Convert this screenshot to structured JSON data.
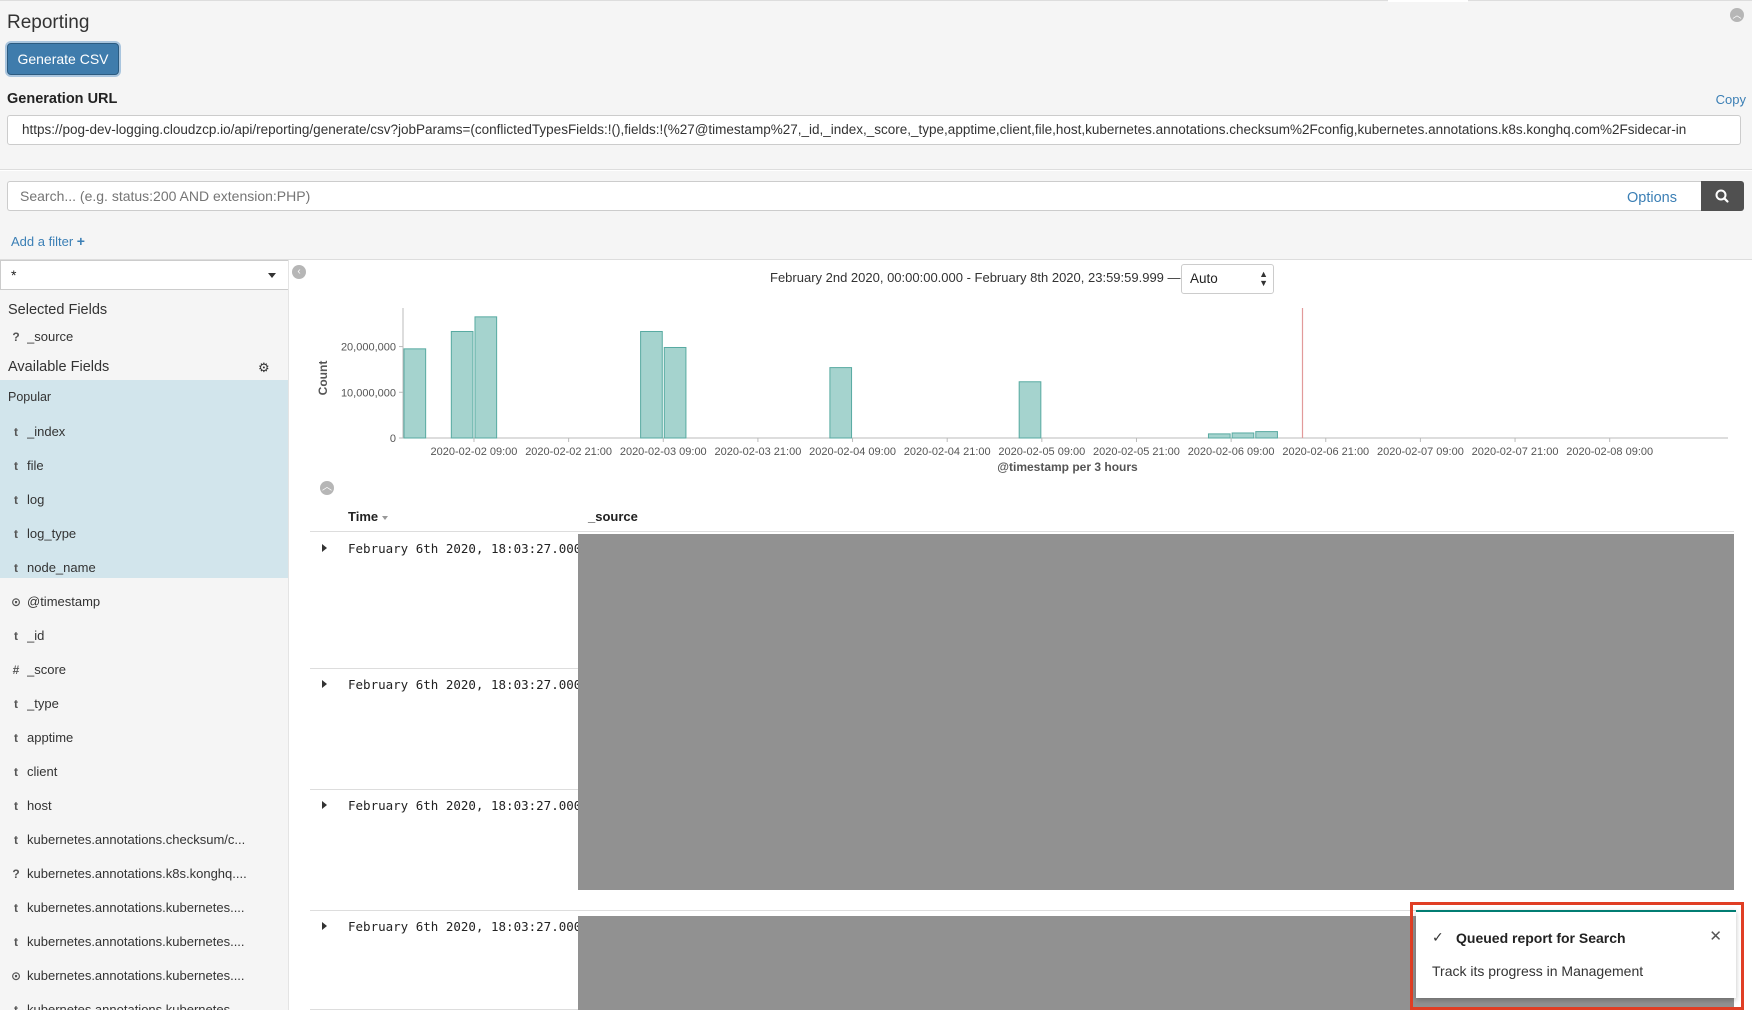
{
  "reporting": {
    "title": "Reporting",
    "generate_button": "Generate CSV",
    "generation_url_label": "Generation URL",
    "copy_label": "Copy",
    "url": "https://pog-dev-logging.cloudzcp.io/api/reporting/generate/csv?jobParams=(conflictedTypesFields:!(),fields:!(%27@timestamp%27,_id,_index,_score,_type,apptime,client,file,host,kubernetes.annotations.checksum%2Fconfig,kubernetes.annotations.k8s.konghq.com%2Fsidecar-in"
  },
  "search": {
    "placeholder": "Search... (e.g. status:200 AND extension:PHP)",
    "options_label": "Options",
    "search_icon": "search-icon"
  },
  "filter": {
    "add_filter_label": "Add a filter",
    "plus": "+"
  },
  "sidebar": {
    "index_pattern": "*",
    "selected_fields_title": "Selected Fields",
    "selected_fields": [
      {
        "type": "?",
        "name": "_source"
      }
    ],
    "available_fields_title": "Available Fields",
    "popular_label": "Popular",
    "popular_fields": [
      {
        "type": "t",
        "name": "_index"
      },
      {
        "type": "t",
        "name": "file"
      },
      {
        "type": "t",
        "name": "log"
      },
      {
        "type": "t",
        "name": "log_type"
      },
      {
        "type": "t",
        "name": "node_name"
      }
    ],
    "other_fields": [
      {
        "type": "⊙",
        "name": "@timestamp"
      },
      {
        "type": "t",
        "name": "_id"
      },
      {
        "type": "#",
        "name": "_score"
      },
      {
        "type": "t",
        "name": "_type"
      },
      {
        "type": "t",
        "name": "apptime"
      },
      {
        "type": "t",
        "name": "client"
      },
      {
        "type": "t",
        "name": "host"
      },
      {
        "type": "t",
        "name": "kubernetes.annotations.checksum/c..."
      },
      {
        "type": "?",
        "name": "kubernetes.annotations.k8s.konghq...."
      },
      {
        "type": "t",
        "name": "kubernetes.annotations.kubernetes...."
      },
      {
        "type": "t",
        "name": "kubernetes.annotations.kubernetes...."
      },
      {
        "type": "⊙",
        "name": "kubernetes.annotations.kubernetes...."
      },
      {
        "type": "t",
        "name": "kubernetes.annotations.kubernetes...."
      }
    ]
  },
  "histogram": {
    "time_range": "February 2nd 2020, 00:00:00.000 - February 8th 2020, 23:59:59.999 —",
    "interval": "Auto"
  },
  "chart_data": {
    "type": "bar",
    "xlabel": "@timestamp per 3 hours",
    "ylabel": "Count",
    "ylim": [
      0,
      28000000
    ],
    "yticks": [
      0,
      10000000,
      20000000
    ],
    "ytick_labels": [
      "0",
      "10,000,000",
      "20,000,000"
    ],
    "x_start": "2020-02-02 00:00",
    "x_end": "2020-02-09 00:00",
    "xtick_labels": [
      "2020-02-02 09:00",
      "2020-02-02 21:00",
      "2020-02-03 09:00",
      "2020-02-03 21:00",
      "2020-02-04 09:00",
      "2020-02-04 21:00",
      "2020-02-05 09:00",
      "2020-02-05 21:00",
      "2020-02-06 09:00",
      "2020-02-06 21:00",
      "2020-02-07 09:00",
      "2020-02-07 21:00",
      "2020-02-08 09:00"
    ],
    "bars": [
      {
        "x": "2020-02-02 00:00",
        "y": 19500000
      },
      {
        "x": "2020-02-02 06:00",
        "y": 23300000
      },
      {
        "x": "2020-02-02 09:00",
        "y": 26500000
      },
      {
        "x": "2020-02-03 06:00",
        "y": 23300000
      },
      {
        "x": "2020-02-03 09:00",
        "y": 19800000
      },
      {
        "x": "2020-02-04 06:00",
        "y": 15400000
      },
      {
        "x": "2020-02-05 06:00",
        "y": 12300000
      },
      {
        "x": "2020-02-06 06:00",
        "y": 900000
      },
      {
        "x": "2020-02-06 09:00",
        "y": 1100000
      },
      {
        "x": "2020-02-06 12:00",
        "y": 1400000
      }
    ],
    "now_marker": "2020-02-06 18:03",
    "bar_color": "#a5d3ce",
    "bar_stroke": "#57aaa1",
    "marker_color": "#e29a9a"
  },
  "table": {
    "time_header": "Time",
    "source_header": "_source",
    "rows": [
      {
        "time": "February 6th 2020, 18:03:27.000"
      },
      {
        "time": "February 6th 2020, 18:03:27.000"
      },
      {
        "time": "February 6th 2020, 18:03:27.000"
      },
      {
        "time": "February 6th 2020, 18:03:27.000"
      }
    ]
  },
  "toast": {
    "title": "Queued report for Search",
    "body": "Track its progress in Management",
    "accent": "#017d73",
    "highlight": "#e03e24"
  }
}
